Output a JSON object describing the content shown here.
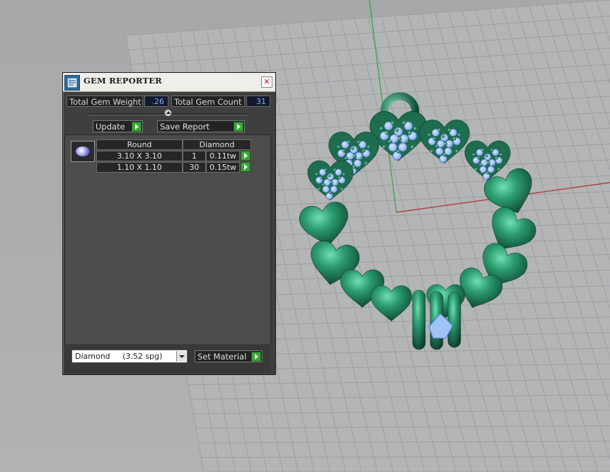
{
  "panel": {
    "title": "GEM REPORTER",
    "close_label": "x",
    "total_weight_label": "Total Gem Weight",
    "total_weight_value": ".26",
    "total_count_label": "Total Gem Count",
    "total_count_value": "31",
    "update_label": "Update",
    "save_report_label": "Save Report",
    "table": {
      "headers": [
        "Round",
        "Diamond"
      ],
      "rows": [
        {
          "size": "3.10 X 3.10",
          "count": "1",
          "weight": "0.11tw"
        },
        {
          "size": "1.10 X 1.10",
          "count": "30",
          "weight": "0.15tw"
        }
      ]
    },
    "material_select": "Diamond     (3.52 spg)",
    "set_material_label": "Set Material"
  },
  "icons": {
    "panel": "gem-reporter-icon",
    "gem": "round-diamond-icon",
    "go": "play-arrow-icon"
  },
  "colors": {
    "panel_bg": "#3f3f3f",
    "value_text": "#7fb0ff",
    "go_button": "#3aa63a",
    "model_green": "#1f7a58",
    "gem_blue": "#9ec3f5",
    "grid_bg": "#a9abad"
  }
}
